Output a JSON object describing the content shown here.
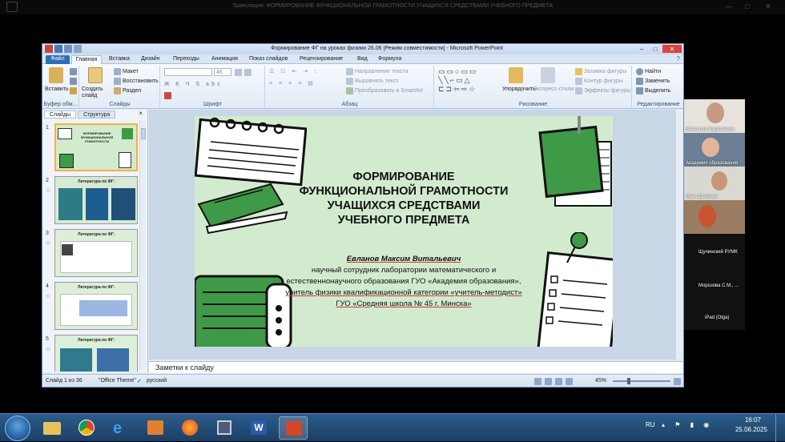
{
  "screen": {
    "top_title": "Трансляция: ФОРМИРОВАНИЕ ФУНКЦИОНАЛЬНОЙ ГРАМОТНОСТИ УЧАЩИХСЯ СРЕДСТВАМИ УЧЕБНОГО ПРЕДМЕТА"
  },
  "powerpoint": {
    "window_title": "Формирование ФГ на уроках физики 26.06 [Режим совместимости] - Microsoft PowerPoint",
    "tabs": [
      "Файл",
      "Главная",
      "Вставка",
      "Дизайн",
      "Переходы",
      "Анимация",
      "Показ слайдов",
      "Рецензирование",
      "Вид",
      "Формула"
    ],
    "ribbon": {
      "clipboard": {
        "paste": "Вставить",
        "name": "Буфер обм..."
      },
      "slides": {
        "create": "Создать слайд",
        "layout": "Макет",
        "reset": "Восстановить",
        "section": "Раздел",
        "name": "Слайды"
      },
      "font": {
        "name": "Шрифт",
        "size_value": "46"
      },
      "paragraph": {
        "direction": "Направление текста",
        "align": "Выровнять текст",
        "smartart": "Преобразовать в SmartArt",
        "name": "Абзац"
      },
      "drawing": {
        "arrange": "Упорядочить",
        "quick_styles": "Экспресс-стили",
        "fill": "Заливка фигуры",
        "outline": "Контур фигуры",
        "effects": "Эффекты фигуры",
        "name": "Рисование"
      },
      "editing": {
        "find": "Найти",
        "replace": "Заменить",
        "select": "Выделить",
        "name": "Редактирование"
      }
    },
    "panel": {
      "tab_slides": "Слайды",
      "tab_outline": "Структура",
      "close": "×",
      "thumbs": [
        {
          "num": "1",
          "title": "ФОРМИРОВАНИЕ ФУНКЦИОНАЛЬНОЙ ГРАМОТНОСТИ"
        },
        {
          "num": "2",
          "title": "Литература по ФГ:"
        },
        {
          "num": "3",
          "title": "Литература по ФГ:"
        },
        {
          "num": "4",
          "title": "Литература по ФГ:"
        },
        {
          "num": "5",
          "title": "Литература по ФГ:"
        }
      ]
    },
    "slide": {
      "title": "ФОРМИРОВАНИЕ ФУНКЦИОНАЛЬНОЙ ГРАМОТНОСТИ УЧАЩИХСЯ СРЕДСТВАМИ УЧЕБНОГО ПРЕДМЕТА",
      "author": "Евланов Максим Витальевич",
      "line1": "научный сотрудник лаборатории математического и",
      "line2": "естественнонаучного образования ГУО «Академия образования»,",
      "line3": "учитель физики квалификационной категории «учитель-методист»",
      "line4": "ГУО «Средняя школа № 45 г. Минска»"
    },
    "notes_placeholder": "Заметки к слайду",
    "status": {
      "slide_info": "Слайд 1 из 36",
      "theme": "\"Office Theme\"",
      "language": "русский",
      "zoom": "45%"
    }
  },
  "video_tiles": [
    {
      "name": "Вячеслав Каратаевич"
    },
    {
      "name": "Академия образования"
    },
    {
      "name": "Макс Евланов"
    },
    {
      "name": ""
    },
    {
      "name": "Щучинский РУМК"
    },
    {
      "name": "Морозова С.М., ..."
    },
    {
      "name": "iPad (Olga)"
    }
  ],
  "taskbar": {
    "lang": "RU",
    "time": "16:07",
    "date": "25.06.2025"
  },
  "colors": {
    "accent_green": "#3f9a47",
    "slide_bg": "#d2ebcf",
    "ribbon_blue": "#2e6eb5"
  }
}
